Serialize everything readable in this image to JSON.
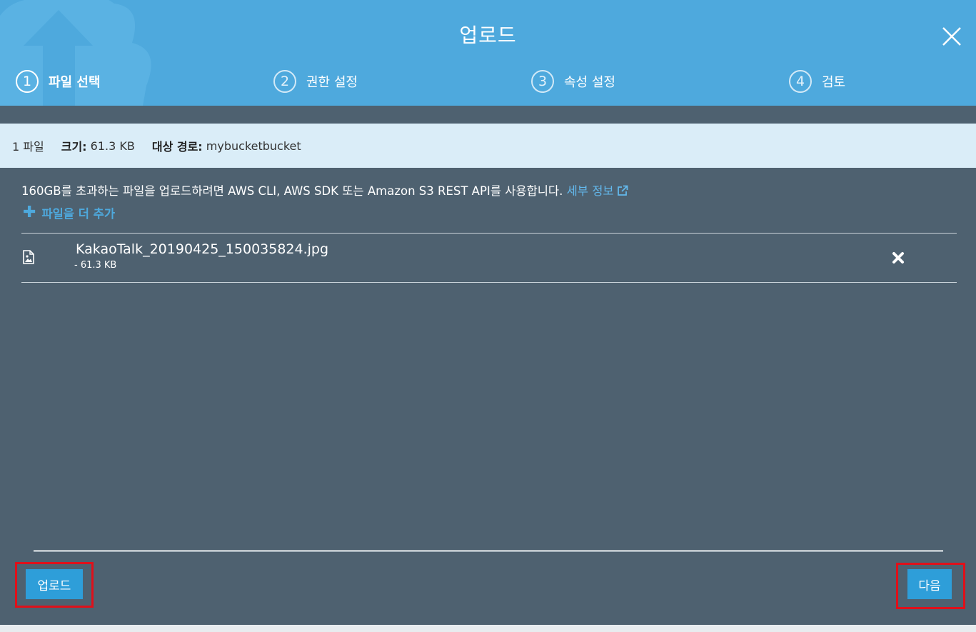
{
  "dialog": {
    "title": "업로드",
    "close_icon": "close-icon"
  },
  "steps": [
    {
      "number": "1",
      "label": "파일 선택",
      "active": true
    },
    {
      "number": "2",
      "label": "권한 설정",
      "active": false
    },
    {
      "number": "3",
      "label": "속성 설정",
      "active": false
    },
    {
      "number": "4",
      "label": "검토",
      "active": false
    }
  ],
  "summary": {
    "file_count": "1 파일",
    "size_label": "크기:",
    "size_value": "61.3 KB",
    "target_label": "대상 경로:",
    "target_value": "mybucketbucket"
  },
  "notice": {
    "text": "160GB를 초과하는 파일을 업로드하려면 AWS CLI, AWS SDK 또는 Amazon S3 REST API를 사용합니다.",
    "link_label": "세부 정보",
    "link_icon": "external-link-icon"
  },
  "add_more": {
    "icon": "plus-icon",
    "label": "파일을 더 추가"
  },
  "files": [
    {
      "name": "KakaoTalk_20190425_150035824.jpg",
      "size": "- 61.3 KB",
      "icon": "image-file-icon",
      "remove_icon": "remove-icon"
    }
  ],
  "footer": {
    "upload_label": "업로드",
    "next_label": "다음"
  },
  "colors": {
    "header": "#4ea9dd",
    "body": "#4e6170",
    "summary": "#daedf8",
    "button": "#2e9ed9",
    "highlight": "#e0101a"
  }
}
